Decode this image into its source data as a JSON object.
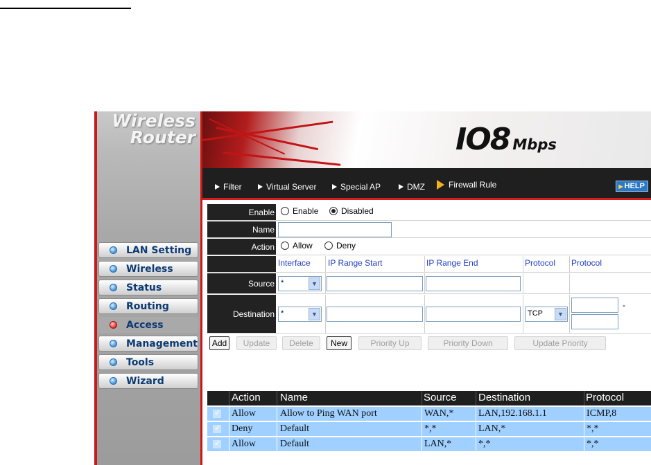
{
  "brand": {
    "line1": "Wireless",
    "line2": "Router",
    "speed": "IO8",
    "speed_unit": "Mbps"
  },
  "nav": {
    "items": [
      "Filter",
      "Virtual Server",
      "Special AP",
      "DMZ",
      "Firewall Rule"
    ],
    "help": "HELP"
  },
  "sidebar": {
    "items": [
      {
        "label": "LAN Setting"
      },
      {
        "label": "Wireless"
      },
      {
        "label": "Status"
      },
      {
        "label": "Routing"
      },
      {
        "label": "Access",
        "active": true
      },
      {
        "label": "Management"
      },
      {
        "label": "Tools"
      },
      {
        "label": "Wizard"
      }
    ]
  },
  "form": {
    "enable_label": "Enable",
    "enable_opt": "Enable",
    "disabled_opt": "Disabled",
    "enable_selected": "Disabled",
    "name_label": "Name",
    "name_value": "",
    "action_label": "Action",
    "allow_opt": "Allow",
    "deny_opt": "Deny",
    "headers": {
      "interface": "Interface",
      "ip_start": "IP Range Start",
      "ip_end": "IP Range End",
      "protocol": "Protocol",
      "protocol2": "Protocol"
    },
    "source_label": "Source",
    "source_interface": "*",
    "destination_label": "Destination",
    "destination_interface": "*",
    "destination_protocol": "TCP",
    "port_dash": "-"
  },
  "buttons": {
    "add": "Add",
    "update": "Update",
    "delete": "Delete",
    "new": "New",
    "priority_up": "Priority Up",
    "priority_down": "Priority Down",
    "update_priority": "Update Priority"
  },
  "rules_table": {
    "headers": [
      "Action",
      "Name",
      "Source",
      "Destination",
      "Protocol"
    ],
    "rows": [
      [
        "Allow",
        "Allow to Ping WAN port",
        "WAN,*",
        "LAN,192.168.1.1",
        "ICMP,8"
      ],
      [
        "Deny",
        "Default",
        "*,*",
        "LAN,*",
        "*,*"
      ],
      [
        "Allow",
        "Default",
        "LAN,*",
        "*,*",
        "*,*"
      ]
    ]
  }
}
